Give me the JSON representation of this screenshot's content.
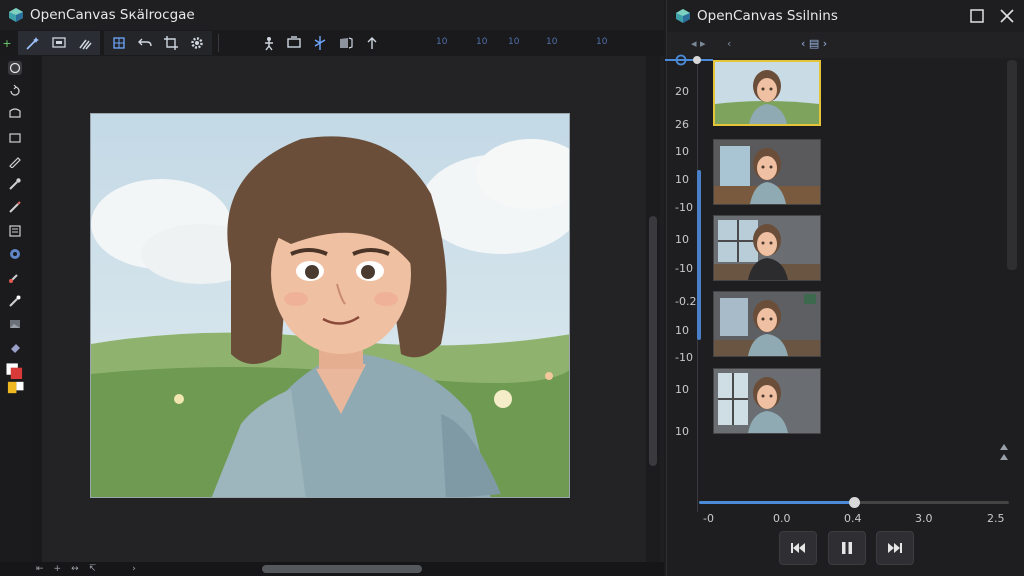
{
  "editor": {
    "title": "OpenCanvas Sкälrocgae",
    "status_glyphs": [
      "⇤",
      "+",
      "↔",
      "↸",
      "›"
    ]
  },
  "toolbar": {
    "icons": [
      "wand-icon",
      "selection-icon",
      "brush-set-icon",
      "transform-icon",
      "undo-icon",
      "crop-icon",
      "settings-icon",
      "puppet-icon",
      "frame-icon",
      "symmetry-icon",
      "layers-icon",
      "arrow-up-icon"
    ],
    "ruler_marks": [
      "10",
      "10",
      "10",
      "10",
      "10"
    ]
  },
  "tools": [
    "lasso-icon",
    "rotate-icon",
    "marquee-icon",
    "rectangle-icon",
    "pen-icon",
    "eyedropper-icon",
    "pencil-icon",
    "text-icon",
    "globe-icon",
    "fill-icon",
    "dropper-icon",
    "image-icon",
    "eraser-icon",
    "color-swatch-icon"
  ],
  "storyboard": {
    "title": "OpenCanvas Ssilnins",
    "nav": [
      "◂ ▸",
      "‹",
      "‹ ▤ ›"
    ],
    "axis_labels": [
      "20",
      "26",
      "10",
      "10",
      "-10",
      "10",
      "-10",
      "-0.2",
      "10",
      "-10",
      "10",
      "10"
    ],
    "frames": [
      {
        "name": "frame-1",
        "selected": true
      },
      {
        "name": "frame-2",
        "selected": false
      },
      {
        "name": "frame-3",
        "selected": false
      },
      {
        "name": "frame-4",
        "selected": false
      },
      {
        "name": "frame-5",
        "selected": false
      }
    ],
    "scrubber": {
      "labels": [
        "-0",
        "0.0",
        "0.4",
        "3.0",
        "2.5"
      ],
      "progress": 0.5
    }
  },
  "colors": {
    "accent": "#4a8ad8",
    "selected_frame": "#e6c43a",
    "background": "#1f1f21"
  }
}
